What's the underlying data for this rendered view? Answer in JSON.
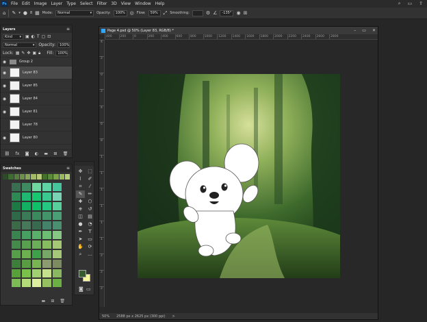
{
  "menu": {
    "logo": "Ps",
    "items": [
      "File",
      "Edit",
      "Image",
      "Layer",
      "Type",
      "Select",
      "Filter",
      "3D",
      "View",
      "Window",
      "Help"
    ]
  },
  "options": {
    "brush_size": "8",
    "mode_label": "Mode:",
    "mode_value": "Normal",
    "opacity_label": "Opacity:",
    "opacity_value": "100%",
    "flow_label": "Flow:",
    "flow_value": "59%",
    "smoothing_label": "Smoothing:",
    "angle_value": "-135°"
  },
  "layers_panel": {
    "tab": "Layers",
    "kind_label": "Kind",
    "blend": "Normal",
    "opacity_label": "Opacity:",
    "opacity_value": "100%",
    "lock_label": "Lock:",
    "fill_label": "Fill:",
    "fill_value": "100%",
    "layers": [
      {
        "name": "Group 2",
        "visible": true,
        "selected": false,
        "type": "group"
      },
      {
        "name": "Layer 83",
        "visible": true,
        "selected": true,
        "type": "layer"
      },
      {
        "name": "Layer 85",
        "visible": true,
        "selected": false,
        "type": "layer"
      },
      {
        "name": "Layer 84",
        "visible": true,
        "selected": false,
        "type": "layer"
      },
      {
        "name": "Layer 81",
        "visible": true,
        "selected": false,
        "type": "layer"
      },
      {
        "name": "Layer 78",
        "visible": false,
        "selected": false,
        "type": "layer"
      },
      {
        "name": "Layer 80",
        "visible": true,
        "selected": false,
        "type": "layer"
      }
    ]
  },
  "swatches_panel": {
    "tab": "Swatches",
    "recent": [
      "#2f4a2a",
      "#3e6b32",
      "#567d3c",
      "#6e8f48",
      "#86a558",
      "#a2b96a",
      "#b9c97c",
      "#44702e",
      "#5a8a3a",
      "#7aa24a",
      "#98b860",
      "#b4cf78"
    ],
    "colors": [
      "#3a6e50",
      "#3f8a60",
      "#6fd8a0",
      "#5ed4a4",
      "#46c49c",
      "#2d8a55",
      "#20b870",
      "#18c870",
      "#3ac890",
      "#78d4b4",
      "#1e7a45",
      "#12b060",
      "#10c068",
      "#24c880",
      "#58d09c",
      "#2e6a48",
      "#3a7a56",
      "#3a8a5e",
      "#44946a",
      "#4aa074",
      "#3a6a48",
      "#48785a",
      "#386a50",
      "#44826a",
      "#4a9070",
      "#3a8450",
      "#48a060",
      "#58b06a",
      "#6cbc74",
      "#86c884",
      "#448a4a",
      "#58a050",
      "#6aae58",
      "#88bc60",
      "#a4c874",
      "#56a04a",
      "#6cb050",
      "#3ea048",
      "#78a868",
      "#a4c878",
      "#3c7e3a",
      "#5a9c44",
      "#78b452",
      "#8c9c70",
      "#7c8c60",
      "#58a03a",
      "#7cc04c",
      "#a0d070",
      "#c4e08c",
      "#8ab860",
      "#7cbc54",
      "#b4dc78",
      "#dcf0a0",
      "#94c060",
      "#6cb044"
    ],
    "fg_color": "#3a5a30",
    "bg_color": "#f6f6a0"
  },
  "tools": [
    "move",
    "artboard",
    "lasso",
    "quick-select",
    "crop",
    "eyedropper",
    "brush",
    "pencil",
    "healing",
    "patch",
    "clone",
    "history-brush",
    "eraser",
    "gradient",
    "blur",
    "dodge",
    "pen",
    "type",
    "path-select",
    "rectangle",
    "hand",
    "rotate",
    "zoom",
    "more"
  ],
  "document": {
    "title": "Page 4.psd @ 50% (Layer 83, RGB/8) *",
    "ruler_top": [
      "400",
      "200",
      "0",
      "200",
      "400",
      "600",
      "800",
      "1000",
      "1200",
      "1400",
      "1600",
      "1800",
      "2000",
      "2200",
      "2400",
      "2600",
      "2800"
    ],
    "ruler_left": [
      "4",
      "2",
      "0",
      "2",
      "4",
      "6",
      "8",
      "1",
      "1",
      "1",
      "1",
      "1",
      "1",
      "2",
      "2",
      "2"
    ],
    "zoom": "50%",
    "doc_info": "2588 px x 2625 px (300 ppi)",
    "status_arrow": ">"
  },
  "colors": {
    "ui_dark": "#262626",
    "panel": "#323232",
    "accent": "#31a8ff",
    "forest_deep": "#14280f",
    "forest_mid": "#3c6a2a",
    "forest_light": "#c8d88a"
  }
}
